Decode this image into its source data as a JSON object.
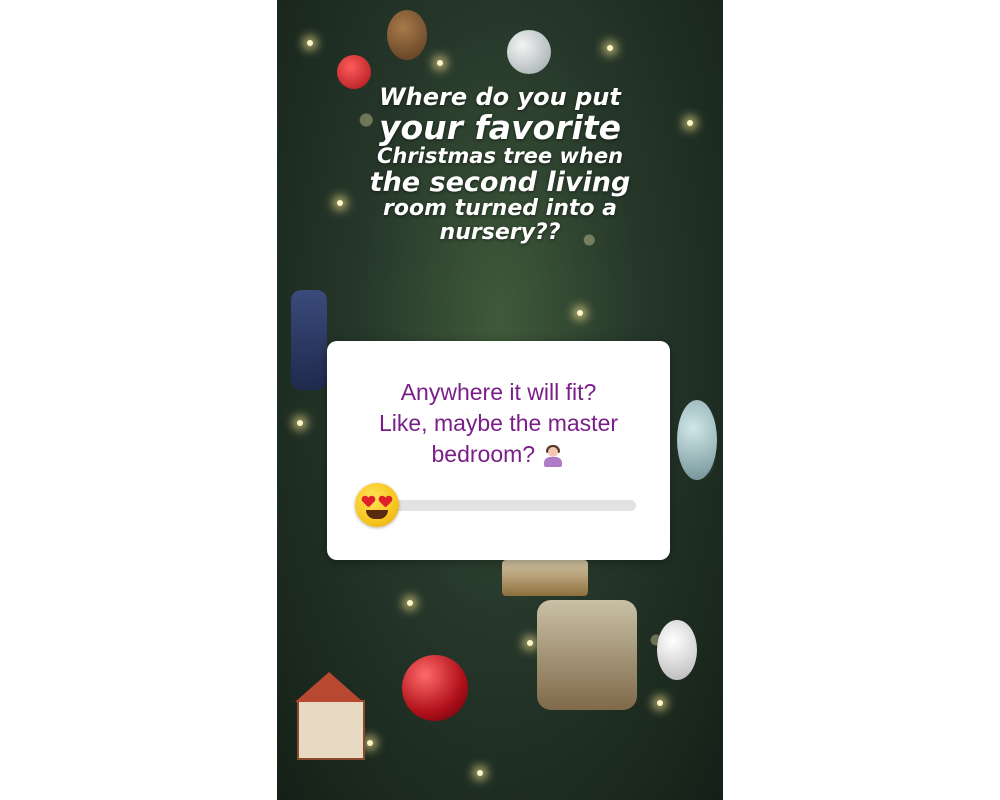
{
  "story": {
    "caption_lines": [
      "Where do you put",
      "your favorite",
      "Christmas tree when",
      "the second living",
      "room turned into a",
      "nursery??"
    ]
  },
  "poll": {
    "question_lines": [
      "Anywhere it will fit?",
      "Like, maybe the master",
      "bedroom?"
    ],
    "slider_emoji": "heart-eyes-emoji",
    "question_emoji": "woman-shrugging-emoji",
    "slider_value": 0
  },
  "colors": {
    "question_text": "#7a1f8a",
    "card_background": "#ffffff",
    "slider_track": "#e2e2e2",
    "caption_text": "#ffffff"
  }
}
